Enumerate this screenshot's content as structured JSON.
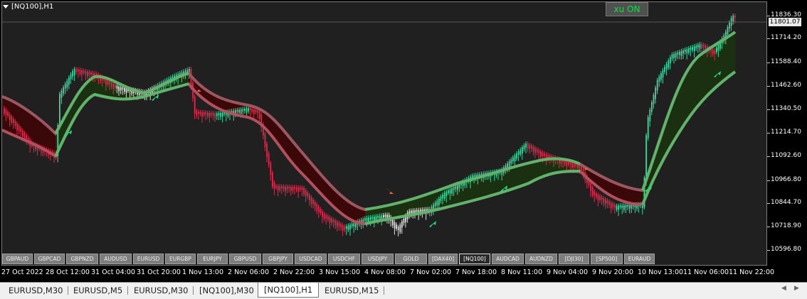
{
  "title": "[NQ100],H1",
  "toggle_button": "xu ON",
  "current_price": "11801.07",
  "price_ticks": [
    "11836.30",
    "11714.20",
    "11588.40",
    "11462.60",
    "11340.50",
    "11214.70",
    "11092.60",
    "10966.80",
    "10844.70",
    "10718.90",
    "10596.80"
  ],
  "time_ticks": [
    "27 Oct 2022",
    "28 Oct 12:00",
    "31 Oct 04:00",
    "31 Oct 20:00",
    "1 Nov 13:00",
    "2 Nov 06:00",
    "2 Nov 22:00",
    "3 Nov 15:00",
    "4 Nov 08:00",
    "7 Nov 02:00",
    "7 Nov 18:00",
    "8 Nov 11:00",
    "9 Nov 04:00",
    "9 Nov 20:00",
    "10 Nov 13:00",
    "11 Nov 06:00",
    "11 Nov 22:00"
  ],
  "symbols": [
    "GBPAUD",
    "GBPCAD",
    "GBPNZD",
    "AUDUSD",
    "EURUSD",
    "EURGBP",
    "EURJPY",
    "GBPUSD",
    "GBPJPY",
    "USDCAD",
    "USDCHF",
    "USDJPY",
    "GOLD",
    "[DAX40]",
    "[NQ100]",
    "AUDCAD",
    "AUDNZD",
    "[DJI30]",
    "[SP500]",
    "EURAUD"
  ],
  "active_symbol": "[NQ100]",
  "tabs": [
    "EURUSD,M30",
    "EURUSD,M5",
    "EURUSD,M30",
    "[NQ100],M30",
    "[NQ100],H1",
    "EURUSD,M15"
  ],
  "active_tab": "[NQ100],H1",
  "colors": {
    "bull": "#3dd7a0",
    "bear": "#e0284a",
    "fast_line": "#c05a6a",
    "slow_line": "#6ab27a",
    "band_up_fill": "#1f3a10",
    "band_down_fill": "#3a0a0a",
    "toggle_text": "#10e040"
  },
  "icons": [
    "chevron-down-icon",
    "scroll-left-icon",
    "scroll-right-icon",
    "buy-arrow-icon",
    "sell-arrow-icon"
  ]
}
